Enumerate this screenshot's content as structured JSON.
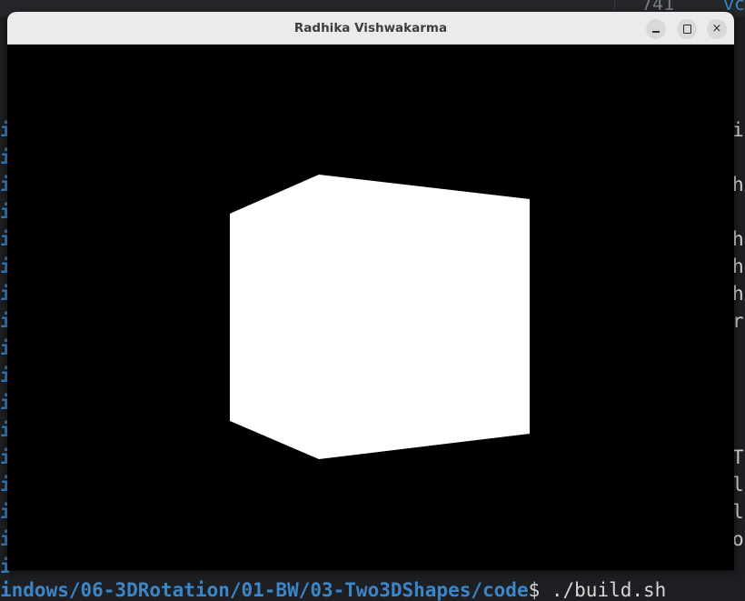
{
  "window": {
    "title": "Radhika Vishwakarma",
    "buttons": {
      "minimize": "–",
      "maximize": "□",
      "close": "×"
    }
  },
  "background": {
    "editor_line_number": "741",
    "editor_code_fragment": "vc",
    "terminal_left_chars": [
      "i",
      "i",
      "i",
      "i",
      "i",
      "i",
      "i",
      "i",
      "i",
      "i",
      "i",
      "i",
      "i",
      "i",
      "i",
      "i",
      "i"
    ],
    "terminal_right_chars": [
      "i",
      "",
      "h",
      "",
      "h",
      "h",
      "h",
      "r",
      "",
      "",
      "",
      "",
      "T",
      "l",
      "l",
      "o",
      ""
    ],
    "terminal_bottom_path": "indows/06-3DRotation/01-BW/03-Two3DShapes/code",
    "terminal_bottom_cmd": "$ ./build.sh"
  },
  "scene": {
    "shape": "cube",
    "fill_color": "#ffffff",
    "background_color": "#000000"
  },
  "colors": {
    "titlebar": "#ebebeb",
    "terminal_blue": "#3a86c8"
  }
}
